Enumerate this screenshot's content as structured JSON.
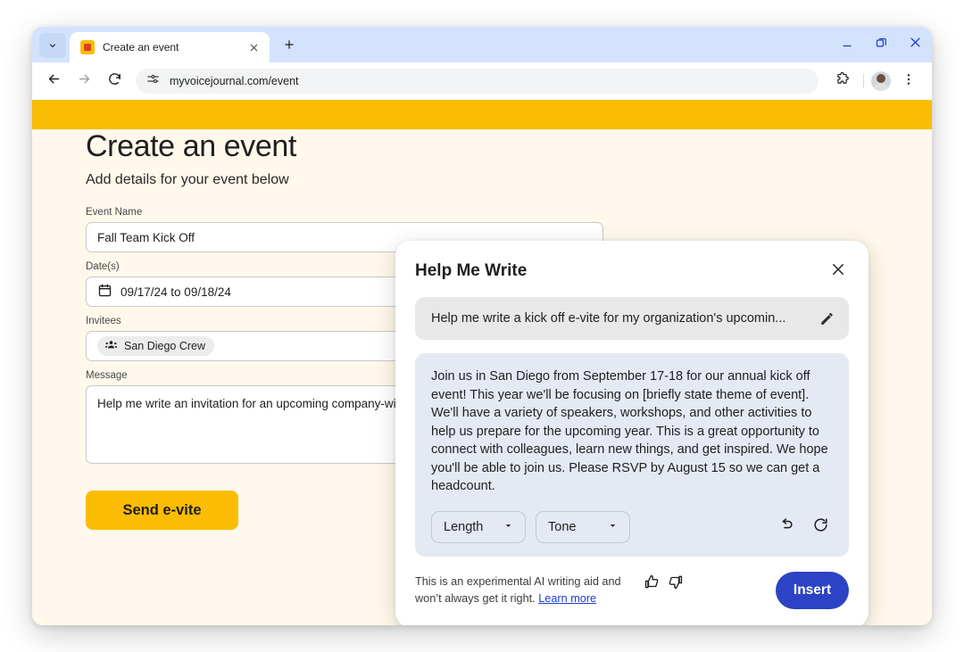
{
  "browser": {
    "tab": {
      "title": "Create an event",
      "favicon": "event-favicon"
    },
    "tab_search_icon": "chevron-down-icon",
    "new_tab_icon": "plus-icon",
    "close_tab_icon": "close-icon",
    "window_controls": {
      "minimize": "minimize-icon",
      "restore": "restore-icon",
      "close": "close-icon"
    },
    "nav": {
      "back": "back-arrow-icon",
      "forward": "forward-arrow-icon",
      "reload": "reload-icon"
    },
    "omnibox": {
      "site_info_icon": "site-settings-icon",
      "url": "myvoicejournal.com/event"
    },
    "toolbar_right": {
      "extensions_icon": "extensions-puzzle-icon",
      "profile_icon": "profile-avatar",
      "menu_icon": "three-dot-menu-icon"
    }
  },
  "page": {
    "banner_color": "#fbbc04",
    "background_color": "#fff8eb",
    "title": "Create an event",
    "subtitle": "Add details for your event below",
    "fields": [
      {
        "label": "Event Name",
        "value": "Fall Team Kick Off",
        "type": "text",
        "name": "event-name"
      },
      {
        "label": "Date(s)",
        "value": "09/17/24 to 09/18/24",
        "type": "date",
        "icon": "calendar-icon",
        "name": "dates"
      },
      {
        "label": "Invitees",
        "value": "San Diego Crew",
        "type": "chip",
        "icon": "groups-icon",
        "name": "invitees"
      },
      {
        "label": "Message",
        "value": "Help me write an invitation for an upcoming company-wide",
        "type": "textarea",
        "name": "message"
      }
    ],
    "send_button": "Send e-vite"
  },
  "dialog": {
    "title": "Help Me Write",
    "close_icon": "close-icon",
    "prompt": {
      "text": "Help me write a kick off e-vite for my organization's upcomin...",
      "edit_icon": "pencil-edit-icon"
    },
    "result": {
      "text": "Join us in San Diego from September 17-18 for our annual kick off event! This year we'll be focusing on [briefly state theme of event]. We'll have a variety of speakers, workshops, and other activities to help us prepare for the upcoming year. This is a great opportunity to connect with colleagues, learn new things, and get inspired. We hope you'll be able to join us. Please RSVP by August 15 so we can get a headcount.",
      "length_dropdown": "Length",
      "tone_dropdown": "Tone",
      "undo_icon": "undo-icon",
      "refresh_icon": "refresh-icon"
    },
    "footer": {
      "disclaimer_line1": "This is an experimental AI writing aid and",
      "disclaimer_line2": "won’t always get it right. ",
      "learn_more": "Learn more",
      "thumbs_up_icon": "thumbs-up-icon",
      "thumbs_down_icon": "thumbs-down-icon",
      "insert_button": "Insert"
    },
    "accent_color": "#2b43c4"
  }
}
